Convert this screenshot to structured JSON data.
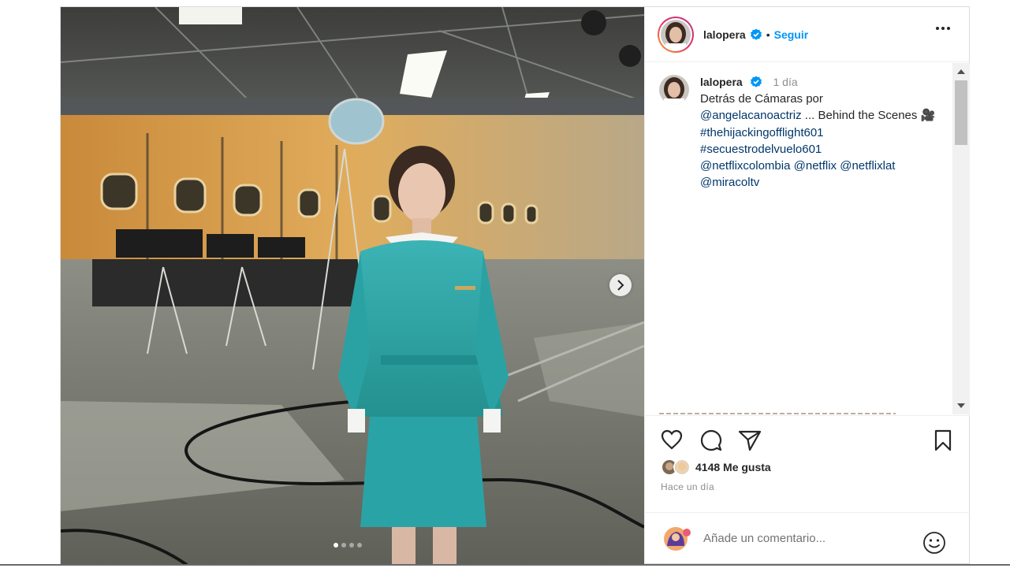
{
  "post": {
    "username": "lalopera",
    "follow_label": "Seguir",
    "separator": "•",
    "caption": {
      "username": "lalopera",
      "time": "1 día",
      "text_1": "Detrás de Cámaras por",
      "mention_1": "@angelacanoactriz",
      "text_2": " ... Behind the Scenes 🎥",
      "hashtag_1": "#thehijackingofflight601",
      "hashtag_2": "#secuestrodelvuelo601",
      "mention_2": "@netflixcolombia",
      "mention_3": "@netflix",
      "mention_4": "@netflixlat",
      "mention_5": "@miracoltv"
    },
    "likes": "4148 Me gusta",
    "time_ago": "Hace un día",
    "comment_placeholder": "Añade un comentario...",
    "carousel": {
      "slides": 4,
      "active": 1
    }
  },
  "colors": {
    "link": "#00376b",
    "follow": "#0095f6",
    "verified": "#0095f6",
    "uniform": "#2aa3a6"
  },
  "icons": [
    "verified-icon",
    "more-icon",
    "chevron-right-icon",
    "heart-icon",
    "comment-icon",
    "share-icon",
    "bookmark-icon",
    "emoji-icon"
  ]
}
